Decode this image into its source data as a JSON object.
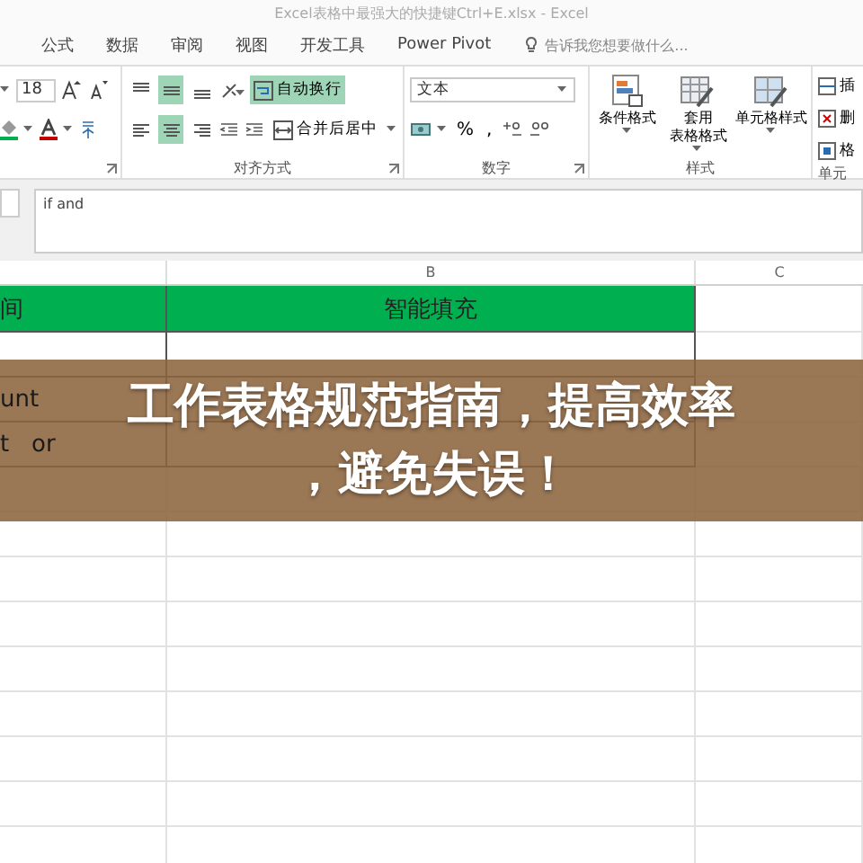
{
  "window": {
    "title": "Excel表格中最强大的快捷键Ctrl+E.xlsx - Excel"
  },
  "menu_tabs": [
    {
      "label": "公式",
      "selected": false
    },
    {
      "label": "数据",
      "selected": false
    },
    {
      "label": "审阅",
      "selected": false
    },
    {
      "label": "视图",
      "selected": false
    },
    {
      "label": "开发工具",
      "selected": false
    },
    {
      "label": "Power Pivot",
      "selected": false
    }
  ],
  "tell_me": {
    "placeholder": "告诉我您想要做什么..."
  },
  "font_group": {
    "font_size": "18"
  },
  "alignment_group": {
    "label": "对齐方式",
    "vertical_align": [
      {
        "kind": "top",
        "selected": false
      },
      {
        "kind": "middle",
        "selected": true
      },
      {
        "kind": "bottom",
        "selected": false
      }
    ],
    "horizontal_align": [
      {
        "kind": "left",
        "selected": false
      },
      {
        "kind": "center",
        "selected": true
      },
      {
        "kind": "right",
        "selected": false
      }
    ],
    "wrap_text": {
      "label": "自动换行",
      "selected": true
    },
    "merge": {
      "label": "合并后居中"
    }
  },
  "number_group": {
    "label": "数字",
    "format": "文本",
    "percent": "%",
    "comma": ","
  },
  "styles_group": {
    "label": "样式",
    "buttons": [
      {
        "kind": "conditional",
        "label_lines": [
          "条件格式"
        ]
      },
      {
        "kind": "table",
        "label_lines": [
          "套用",
          "表格格式"
        ]
      },
      {
        "kind": "cell",
        "label_lines": [
          "单元格样式"
        ]
      }
    ]
  },
  "cells_group": {
    "label": "单元",
    "buttons": [
      {
        "kind": "insert",
        "label": "插"
      },
      {
        "kind": "delete",
        "label": "删"
      },
      {
        "kind": "format",
        "label": "格"
      }
    ]
  },
  "formula_bar": {
    "value": "if and"
  },
  "sheet": {
    "columns": [
      {},
      {
        "header": "B"
      },
      {
        "header": "C"
      }
    ],
    "rows": [
      {
        "kind": "header",
        "cells": [
          "间",
          "智能填充",
          null
        ]
      },
      {
        "kind": "table",
        "cells": [
          null,
          null,
          null
        ]
      },
      {
        "kind": "table",
        "cells": [
          "unt",
          null,
          null
        ]
      },
      {
        "kind": "table",
        "cells": [
          "t   or",
          null,
          null
        ]
      },
      {
        "kind": "plain",
        "cells": [
          null,
          null,
          null
        ]
      },
      {
        "kind": "plain",
        "cells": [
          null,
          null,
          null
        ]
      },
      {
        "kind": "plain",
        "cells": [
          null,
          null,
          null
        ]
      },
      {
        "kind": "plain",
        "cells": [
          null,
          null,
          null
        ]
      },
      {
        "kind": "plain",
        "cells": [
          null,
          null,
          null
        ]
      },
      {
        "kind": "plain",
        "cells": [
          null,
          null,
          null
        ]
      },
      {
        "kind": "plain",
        "cells": [
          null,
          null,
          null
        ]
      },
      {
        "kind": "plain",
        "cells": [
          null,
          null,
          null
        ]
      },
      {
        "kind": "plain",
        "cells": [
          null,
          null,
          null
        ]
      }
    ]
  },
  "banner": {
    "lines": [
      "工作表格规范指南，提高效率",
      "，避免失误！"
    ]
  }
}
